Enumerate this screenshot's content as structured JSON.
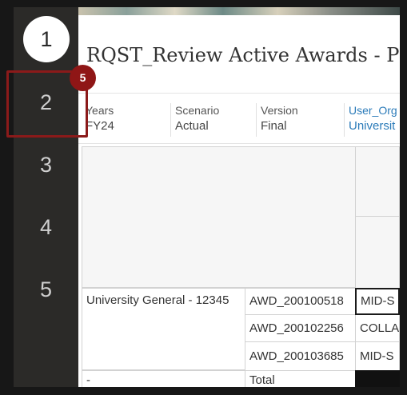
{
  "steps": {
    "step1": "1",
    "step2": "2",
    "step3": "3",
    "step4": "4",
    "step5": "5"
  },
  "page": {
    "title": "RQST_Review Active Awards - P"
  },
  "pov": {
    "years_label": "Years",
    "years_value": "FY24",
    "scenario_label": "Scenario",
    "scenario_value": "Actual",
    "version_label": "Version",
    "version_value": "Final",
    "user_org_label": "User_Org",
    "user_org_value": "Universit"
  },
  "grid": {
    "row_header_1": "University General - 12345",
    "row_header_2": "-",
    "award_1": "AWD_200100518",
    "award_2": "AWD_200102256",
    "award_3": "AWD_200103685",
    "total": "Total",
    "data_1": "MID-S",
    "data_2": "COLLA",
    "data_3": "MID-S"
  },
  "callout": {
    "badge_number": "5"
  },
  "colors": {
    "callout": "#8b1a1a",
    "link": "#2b7bb9",
    "sidebar": "#2b2a28"
  }
}
